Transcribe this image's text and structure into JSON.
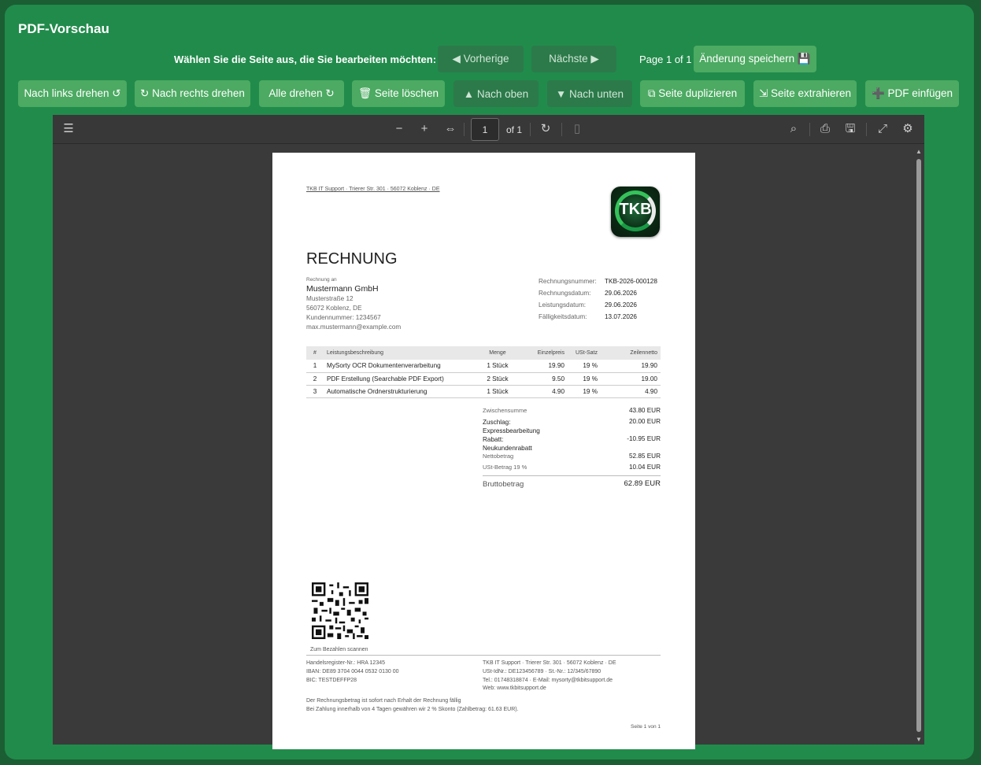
{
  "title": "PDF-Vorschau",
  "nav": {
    "label": "Wählen Sie die Seite aus, die Sie bearbeiten möchten:",
    "prev": "◀ Vorherige",
    "next": "Nächste ▶",
    "page_info": "Page 1 of 1",
    "save": "Änderung speichern 💾"
  },
  "actions": [
    "Nach links drehen ↺",
    "↻ Nach rechts drehen",
    "Alle drehen ↻",
    "🗑 Seite löschen",
    "▲ Nach oben",
    "▼ Nach unten",
    "⧉ Seite duplizieren",
    "⇲ Seite extrahieren",
    "➕ PDF einfügen"
  ],
  "viewer": {
    "page_input": "1",
    "of_pages": "of 1",
    "icons": [
      "sidebar-toggle-icon",
      "zoom-out-icon",
      "zoom-in-icon",
      "fit-width-icon",
      "rotate-icon",
      "spread-icon",
      "search-icon",
      "print-icon",
      "save-icon",
      "fullscreen-icon",
      "settings-icon"
    ]
  },
  "invoice": {
    "sender_line": "TKB IT Support · Trierer Str. 301 · 56072 Koblenz · DE",
    "logo_text": "TKB",
    "heading": "RECHNUNG",
    "bill_to_label": "Rechnung an",
    "customer": {
      "name": "Mustermann GmbH",
      "street": "Musterstraße 12",
      "city": "56072 Koblenz, DE",
      "customer_no": "Kundennummer: 1234567",
      "email": "max.mustermann@example.com"
    },
    "meta": [
      {
        "label": "Rechnungsnummer:",
        "value": "TKB-2026-000128"
      },
      {
        "label": "Rechnungsdatum:",
        "value": "29.06.2026"
      },
      {
        "label": "Leistungsdatum:",
        "value": "29.06.2026"
      },
      {
        "label": "Fälligkeitsdatum:",
        "value": "13.07.2026"
      }
    ],
    "table_headers": [
      "#",
      "Leistungsbeschreibung",
      "Menge",
      "Einzelpreis",
      "USt-Satz",
      "Zeilennetto"
    ],
    "rows": [
      [
        "1",
        "MySorty OCR Dokumentenverarbeitung",
        "1 Stück",
        "19.90",
        "19 %",
        "19.90"
      ],
      [
        "2",
        "PDF Erstellung (Searchable PDF Export)",
        "2 Stück",
        "9.50",
        "19 %",
        "19.00"
      ],
      [
        "3",
        "Automatische Ordnerstrukturierung",
        "1 Stück",
        "4.90",
        "19 %",
        "4.90"
      ]
    ],
    "totals": {
      "zwischensumme_label": "Zwischensumme",
      "zwischensumme": "43.80 EUR",
      "zuschlag_label": "Zuschlag:",
      "zuschlag_desc": "Expressbearbeitung",
      "zuschlag": "20.00 EUR",
      "rabatt_label": "Rabatt:",
      "rabatt_desc": "Neukundenrabatt",
      "rabatt": "-10.95 EUR",
      "netto_label": "Nettobetrag",
      "netto": "52.85 EUR",
      "ust_label": "USt-Betrag 19 %",
      "ust": "10.04 EUR",
      "brutto_label": "Bruttobetrag",
      "brutto": "62.89 EUR"
    },
    "qr_caption": "Zum Bezahlen scannen",
    "footer_left": [
      "Handelsregister-Nr.: HRA 12345",
      "IBAN: DE89 3704 0044 0532 0130 00",
      "BIC: TESTDEFFP28"
    ],
    "footer_right": [
      "TKB IT Support · Trierer Str. 301 · 56072 Koblenz · DE",
      "USt-IdNr.: DE123456789 · St.-Nr.: 12/345/67890",
      "Tel.: 01748318874 · E-Mail: mysorty@tkbitsupport.de",
      "Web: www.tkbitsupport.de"
    ],
    "note1": "Der Rechnungsbetrag ist sofort nach Erhalt der Rechnung fällig",
    "note2": "Bei Zahlung innerhalb von 4 Tagen gewähren wir 2 % Skonto (Zahlbetrag: 61.63 EUR).",
    "page_footer": "Seite 1 von 1"
  }
}
